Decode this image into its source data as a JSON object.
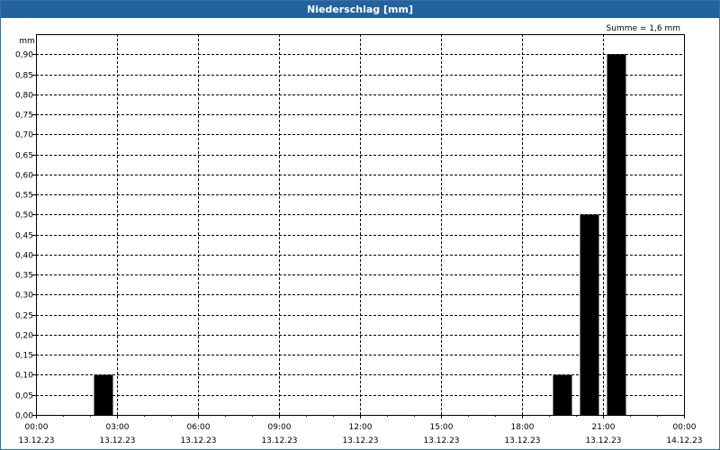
{
  "window": {
    "title": "Niederschlag [mm]"
  },
  "chart_data": {
    "type": "bar",
    "title": "Niederschlag [mm]",
    "ylabel": "mm",
    "annotation": "Summe = 1,6 mm",
    "ylim": [
      0,
      0.95
    ],
    "xlim_hours": [
      0,
      24
    ],
    "y_ticks": [
      "0,00",
      "0,05",
      "0,10",
      "0,15",
      "0,20",
      "0,25",
      "0,30",
      "0,35",
      "0,40",
      "0,45",
      "0,50",
      "0,55",
      "0,60",
      "0,65",
      "0,70",
      "0,75",
      "0,80",
      "0,85",
      "0,90"
    ],
    "x_ticks": [
      {
        "time": "00:00",
        "date": "13.12.23"
      },
      {
        "time": "03:00",
        "date": "13.12.23"
      },
      {
        "time": "06:00",
        "date": "13.12.23"
      },
      {
        "time": "09:00",
        "date": "13.12.23"
      },
      {
        "time": "12:00",
        "date": "13.12.23"
      },
      {
        "time": "15:00",
        "date": "13.12.23"
      },
      {
        "time": "18:00",
        "date": "13.12.23"
      },
      {
        "time": "21:00",
        "date": "13.12.23"
      },
      {
        "time": "00:00",
        "date": "14.12.23"
      }
    ],
    "bars": [
      {
        "time": "13.12.23 02:30",
        "value": 0.1
      },
      {
        "time": "13.12.23 19:30",
        "value": 0.1
      },
      {
        "time": "13.12.23 20:30",
        "value": 0.5
      },
      {
        "time": "13.12.23 21:30",
        "value": 0.9
      }
    ],
    "grid": true,
    "colors": {
      "bar": "#000000",
      "titlebar": "#22639f",
      "frame": "#3b6ea5"
    }
  }
}
